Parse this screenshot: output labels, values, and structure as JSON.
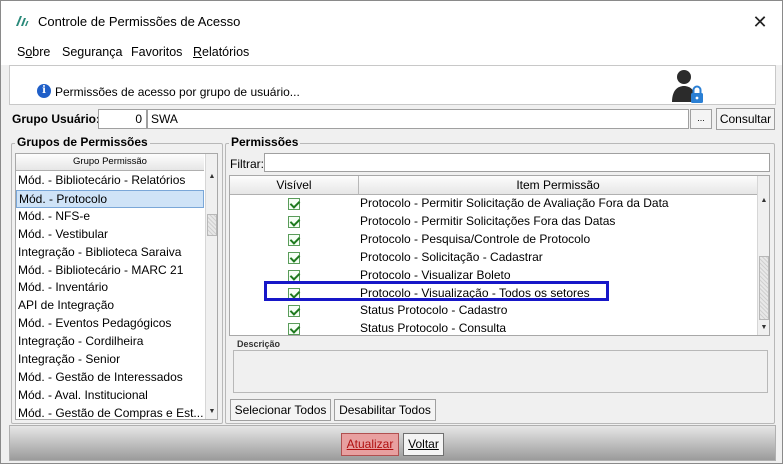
{
  "window": {
    "title": "Controle de Permissões de Acesso",
    "close_glyph": "✕"
  },
  "menu": [
    {
      "label": "Sobre",
      "accel": "o"
    },
    {
      "label": "Segurança",
      "accel": ""
    },
    {
      "label": "Favoritos",
      "accel": ""
    },
    {
      "label": "Relatórios",
      "accel": "R"
    }
  ],
  "banner": {
    "text": "Permissões de acesso por grupo de usuário..."
  },
  "group_user": {
    "label": "Grupo Usuário:",
    "code": "0",
    "name": "SWA",
    "lookup_label": "...",
    "consult_label": "Consultar"
  },
  "groups_panel": {
    "title": "Grupos de Permissões",
    "column_header": "Grupo Permissão",
    "items": [
      "Mód. - Bibliotecário - Relatórios",
      "Mód. - Protocolo",
      "Mód. - NFS-e",
      "Mód. - Vestibular",
      "Integração - Biblioteca Saraiva",
      "Mód. - Bibliotecário - MARC 21",
      "Mód. - Inventário",
      "API de Integração",
      "Mód. - Eventos Pedagógicos",
      "Integração - Cordilheira",
      "Integração - Senior",
      "Mód. - Gestão de Interessados",
      "Mód. - Aval. Institucional",
      "Mód. - Gestão de Compras e Est..."
    ],
    "selected_index": 1
  },
  "permissions_panel": {
    "title": "Permissões",
    "filter_label": "Filtrar:",
    "filter_value": "",
    "columns": [
      "Visível",
      "Item Permissão"
    ],
    "rows": [
      {
        "visible": true,
        "item": "Protocolo - Permitir Solicitação de Avaliação Fora da Data"
      },
      {
        "visible": true,
        "item": "Protocolo - Permitir Solicitações Fora das Datas"
      },
      {
        "visible": true,
        "item": "Protocolo - Pesquisa/Controle de Protocolo"
      },
      {
        "visible": true,
        "item": "Protocolo - Solicitação - Cadastrar"
      },
      {
        "visible": true,
        "item": "Protocolo - Visualizar Boleto"
      },
      {
        "visible": true,
        "item": "Protocolo - Visualização - Todos os setores"
      },
      {
        "visible": true,
        "item": "Status Protocolo - Cadastro"
      },
      {
        "visible": true,
        "item": "Status Protocolo - Consulta"
      }
    ],
    "highlighted_row_index": 5,
    "description_label": "Descrição",
    "description_value": "",
    "select_all_label": "Selecionar Todos",
    "deselect_all_label": "Desabilitar Todos"
  },
  "footer": {
    "update_label": "Atualizar",
    "back_label": "Voltar"
  },
  "colors": {
    "highlight_border": "#1717c8",
    "selected_row": "#cfe3f7",
    "update_button": "#e8a0a0"
  }
}
